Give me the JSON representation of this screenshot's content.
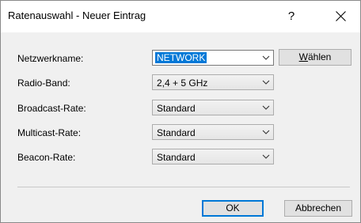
{
  "window": {
    "title": "Ratenauswahl - Neuer Eintrag",
    "help_label": "?",
    "close_icon": "close-icon"
  },
  "fields": {
    "network_name": {
      "label": "Netzwerkname:",
      "value": "NETWORK"
    },
    "radio_band": {
      "label": "Radio-Band:",
      "value": "2,4 + 5 GHz"
    },
    "broadcast_rate": {
      "label": "Broadcast-Rate:",
      "value": "Standard"
    },
    "multicast_rate": {
      "label": "Multicast-Rate:",
      "value": "Standard"
    },
    "beacon_rate": {
      "label": "Beacon-Rate:",
      "value": "Standard"
    }
  },
  "buttons": {
    "choose_mnemonic": "W",
    "choose_rest": "ählen",
    "ok": "OK",
    "cancel": "Abbrechen"
  },
  "colors": {
    "selection": "#0078d7",
    "dialog_bg": "#f0f0f0"
  }
}
